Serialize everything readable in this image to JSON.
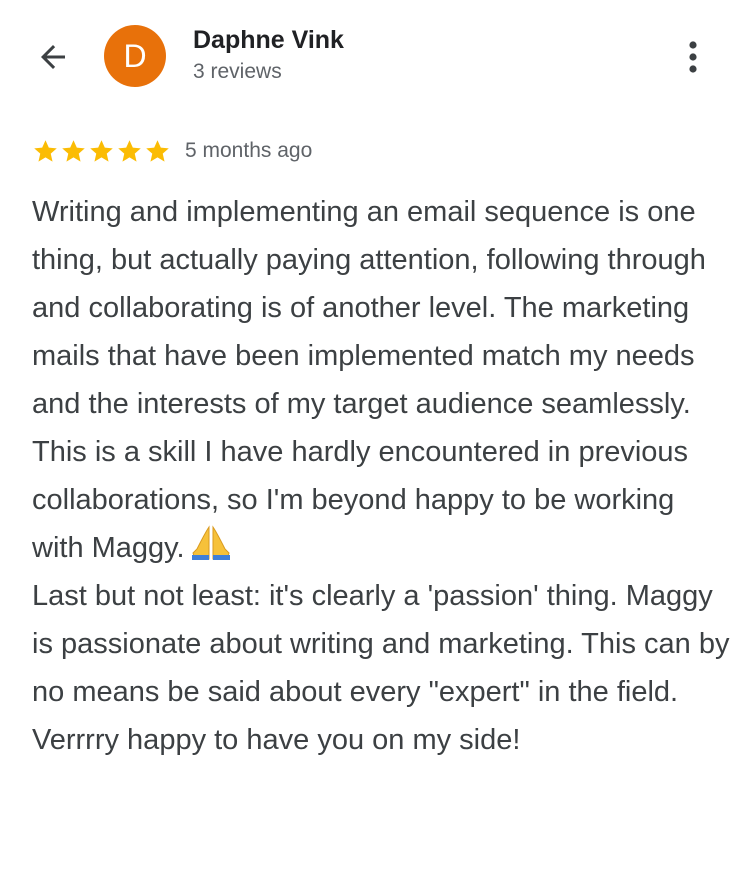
{
  "header": {
    "back_icon": "arrow-left-icon",
    "avatar_letter": "D",
    "avatar_color": "#e8710a",
    "user_name": "Daphne Vink",
    "review_count": "3 reviews",
    "more_icon": "more-vertical-icon"
  },
  "review": {
    "rating": 5,
    "rating_max": 5,
    "star_color": "#fbbc04",
    "time_ago": "5 months ago",
    "paragraph_1": "Writing and implementing an email sequence is one thing, but actually paying attention, following through and collaborating is of another level. The marketing mails that have been implemented match my needs and the interests of my target audience seamlessly. This is a skill I have hardly encountered in previous collaborations, so I'm beyond happy to be working with Maggy.",
    "emoji_icon": "folded-hands-icon",
    "paragraph_2": "Last but not least: it's clearly a 'passion' thing. Maggy is passionate about writing and marketing. This can by no means be said about every \"expert\" in the field. Verrrry happy to have you on my side!"
  }
}
